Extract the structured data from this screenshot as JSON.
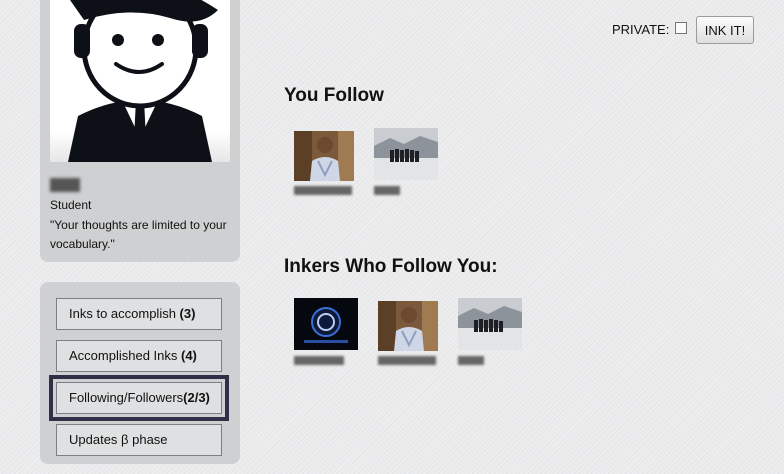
{
  "profile": {
    "name": "Bapi",
    "role": "Student",
    "quote": "\"Your thoughts are limited to your vocabulary.\""
  },
  "menu": {
    "items": [
      {
        "label": "Inks to accomplish ",
        "count": "(3)"
      },
      {
        "label": "Accomplished Inks ",
        "count": "(4)"
      },
      {
        "label": "Following/Followers",
        "count": "(2/3)"
      },
      {
        "label": "Updates β phase",
        "count": ""
      }
    ]
  },
  "toolbar": {
    "private_label": "PRIVATE:",
    "private_checked": false,
    "ink_button": "INK IT!"
  },
  "following": {
    "heading": "You Follow",
    "users": [
      {
        "name": "Himanshu",
        "thumb": "person-photo"
      },
      {
        "name": "Neel",
        "thumb": "group-snow-photo"
      }
    ]
  },
  "followers": {
    "heading": "Inkers Who Follow You:",
    "users": [
      {
        "name": "Supriyo",
        "thumb": "logo-dark-photo"
      },
      {
        "name": "Himanshu",
        "thumb": "person-photo"
      },
      {
        "name": "Neel",
        "thumb": "group-snow-photo"
      }
    ]
  }
}
